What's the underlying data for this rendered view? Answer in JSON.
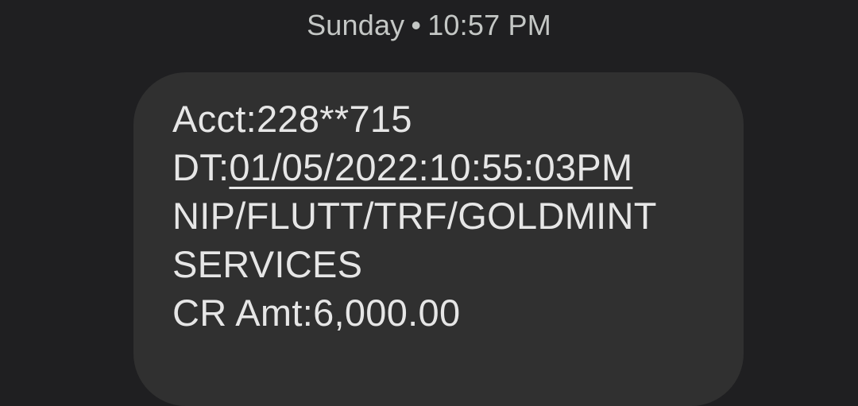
{
  "conversation": {
    "timestamp": {
      "day": "Sunday",
      "separator": "•",
      "time": "10:57 PM"
    },
    "message": {
      "acct_line": "Acct:228**715",
      "dt_prefix": "DT:",
      "dt_value": "01/05/2022:10:55:03PM",
      "desc_line1": "NIP/FLUTT/TRF/GOLDMINT",
      "desc_line2": "SERVICES",
      "amount_line": "CR Amt:6,000.00"
    }
  }
}
